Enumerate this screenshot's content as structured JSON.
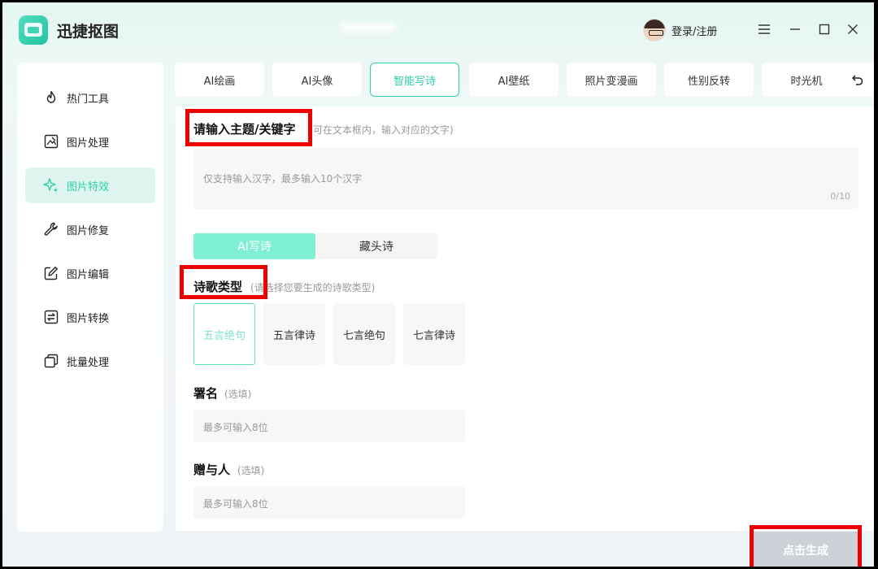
{
  "app": {
    "title": "迅捷抠图",
    "login_label": "登录/注册"
  },
  "sidebar": {
    "items": [
      {
        "label": "热门工具",
        "icon": "flame-icon"
      },
      {
        "label": "图片处理",
        "icon": "image-edit-icon"
      },
      {
        "label": "图片特效",
        "icon": "sparkle-icon",
        "active": true
      },
      {
        "label": "图片修复",
        "icon": "wrench-icon"
      },
      {
        "label": "图片编辑",
        "icon": "pencil-square-icon"
      },
      {
        "label": "图片转换",
        "icon": "convert-icon"
      },
      {
        "label": "批量处理",
        "icon": "stack-icon"
      }
    ]
  },
  "tabs": [
    {
      "label": "AI绘画"
    },
    {
      "label": "AI头像"
    },
    {
      "label": "智能写诗",
      "active": true
    },
    {
      "label": "AI壁纸"
    },
    {
      "label": "照片变漫画"
    },
    {
      "label": "性别反转"
    },
    {
      "label": "时光机"
    }
  ],
  "topic": {
    "title": "请输入主题/关键字",
    "hint": "可在文本框内，输入对应的文字)",
    "placeholder": "仅支持输入汉字，最多输入10个汉字",
    "counter": "0/10"
  },
  "modes": [
    {
      "label": "AI写诗",
      "active": true
    },
    {
      "label": "藏头诗"
    }
  ],
  "poem_type": {
    "title": "诗歌类型",
    "hint": "(请选择您要生成的诗歌类型)",
    "options": [
      {
        "label": "五言绝句",
        "active": true
      },
      {
        "label": "五言律诗"
      },
      {
        "label": "七言绝句"
      },
      {
        "label": "七言律诗"
      }
    ]
  },
  "signature": {
    "title": "署名",
    "hint": "(选填)",
    "placeholder": "最多可输入8位"
  },
  "recipient": {
    "title": "赠与人",
    "hint": "(选填)",
    "placeholder": "最多可输入8位"
  },
  "generate_label": "点击生成",
  "colors": {
    "accent": "#2ccfaa",
    "highlight_box": "#ee0000",
    "active_mode": "#7ff0d3"
  }
}
